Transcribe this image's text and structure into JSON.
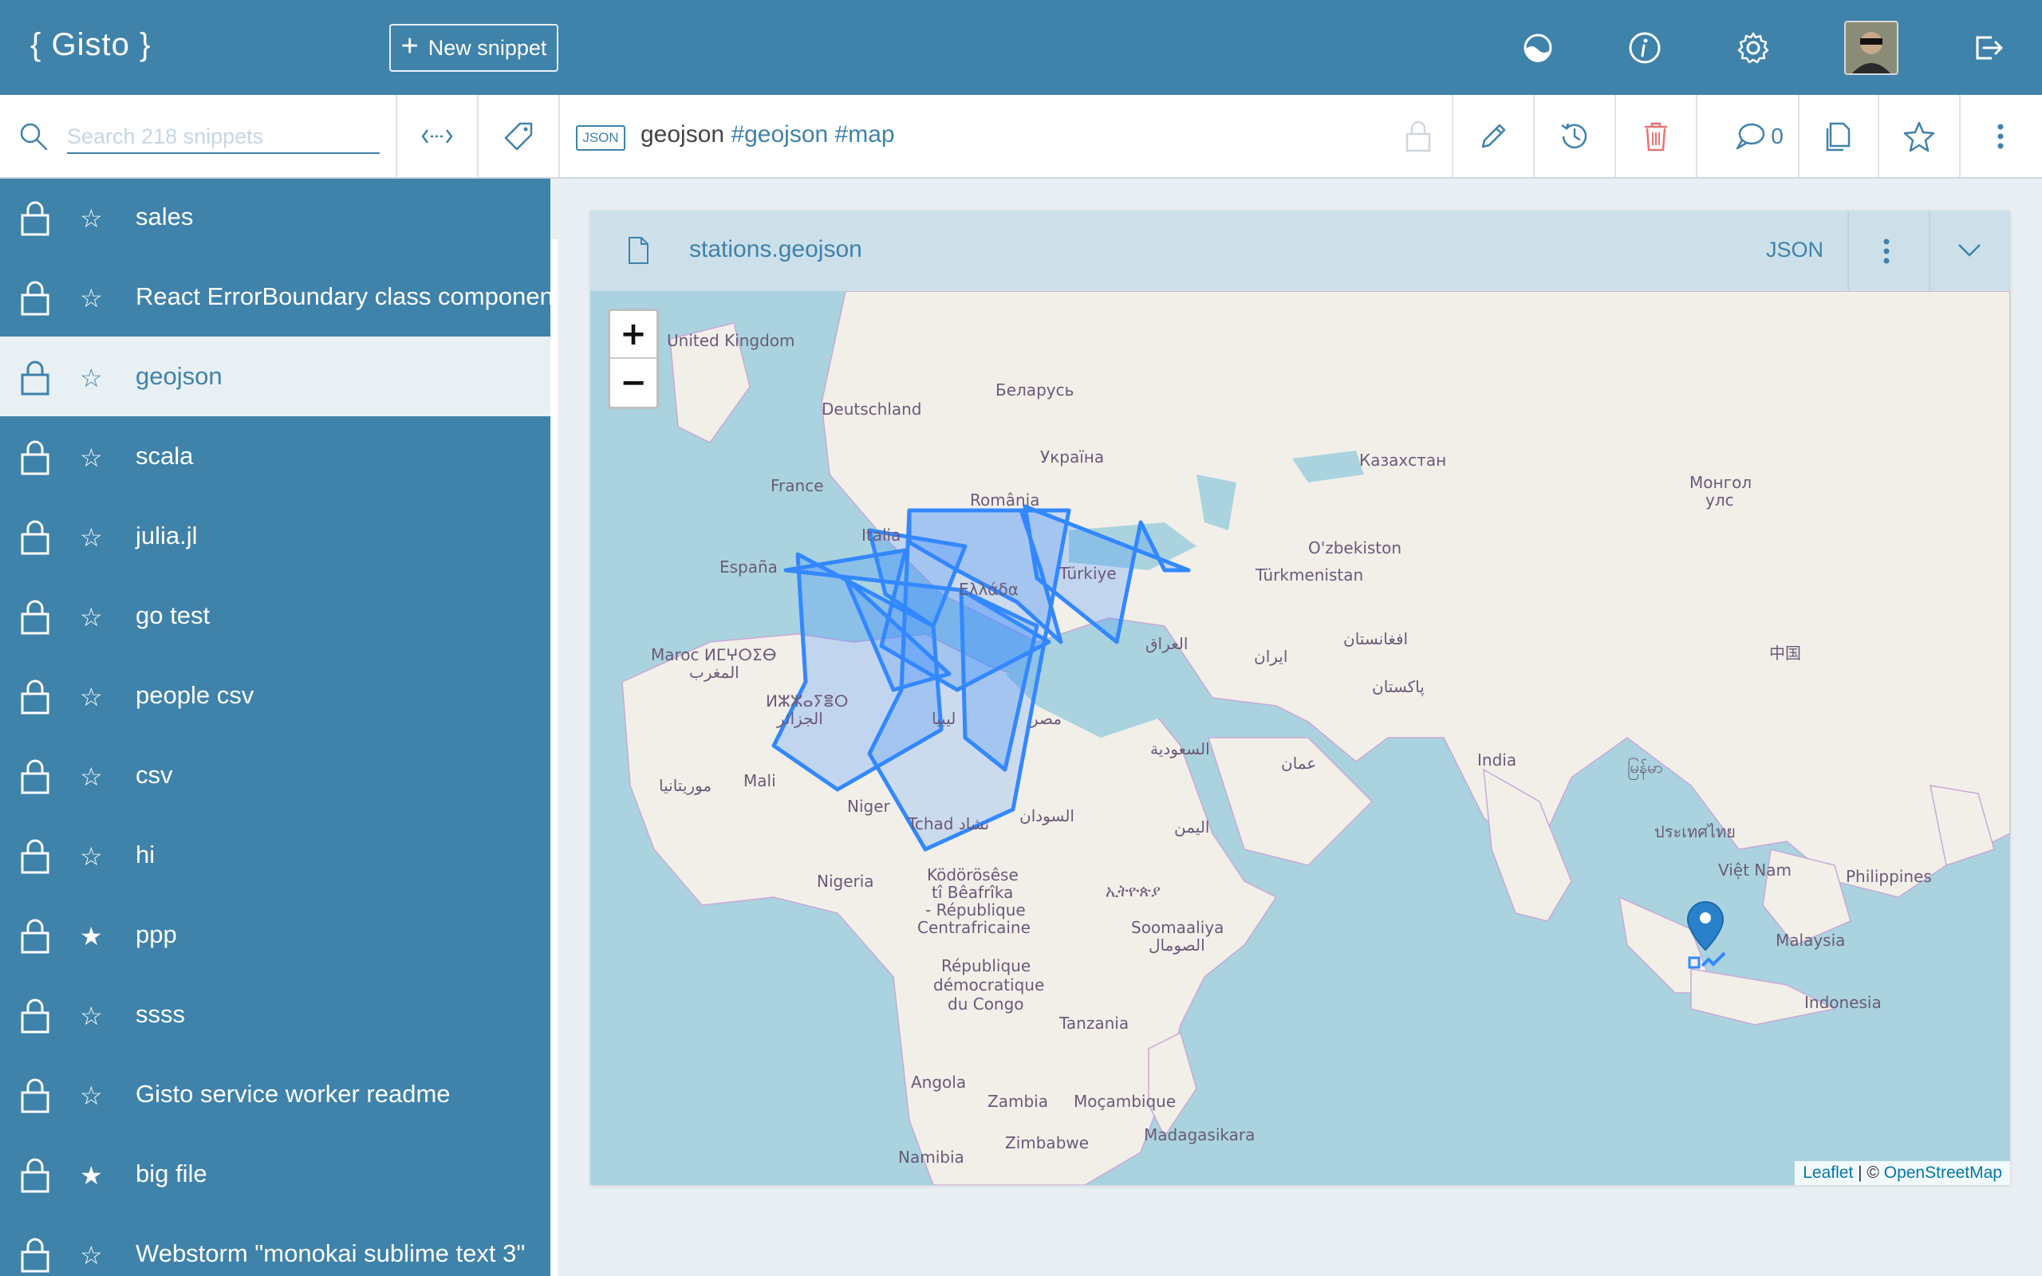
{
  "app": {
    "logo": "{ Gisto }",
    "new_snippet_label": "New snippet"
  },
  "header_icons": [
    "theme-icon",
    "info-icon",
    "settings-icon",
    "user-avatar",
    "logout-icon"
  ],
  "toolbar": {
    "search_placeholder": "Search 218 snippets",
    "snippet_lang_badge": "JSON",
    "snippet_name": "geojson",
    "snippet_tags": "#geojson #map",
    "comment_count": "0"
  },
  "sidebar": {
    "items": [
      {
        "label": "sales",
        "starred": false
      },
      {
        "label": "React ErrorBoundary class component",
        "starred": false
      },
      {
        "label": "geojson",
        "starred": false,
        "active": true
      },
      {
        "label": "scala",
        "starred": false
      },
      {
        "label": "julia.jl",
        "starred": false
      },
      {
        "label": "go test",
        "starred": false
      },
      {
        "label": "people csv",
        "starred": false
      },
      {
        "label": "csv",
        "starred": false
      },
      {
        "label": "hi",
        "starred": false
      },
      {
        "label": "ppp",
        "starred": true
      },
      {
        "label": "ssss",
        "starred": false
      },
      {
        "label": "Gisto service worker readme",
        "starred": false
      },
      {
        "label": "big file",
        "starred": true
      },
      {
        "label": "Webstorm \"monokai sublime text 3\"",
        "starred": false
      }
    ]
  },
  "file": {
    "name": "stations.geojson",
    "language": "JSON"
  },
  "map": {
    "zoom_in": "+",
    "zoom_out": "−",
    "attribution_link1": "Leaflet",
    "attribution_sep": " | © ",
    "attribution_link2": "OpenStreetMap",
    "labels": {
      "uk": "United Kingdom",
      "belarus": "Беларусь",
      "germany": "Deutschland",
      "ukraine": "Україна",
      "kazakhstan": "Казахстан",
      "mongolia": "Монгол",
      "mongolia2": "улс",
      "france": "France",
      "romania": "România",
      "italia": "Italia",
      "uzbekistan": "O'zbekiston",
      "turkiye": "Türkiye",
      "turkmenistan": "Türkmenistan",
      "espana": "España",
      "greece": "Ελλάδα",
      "iraq": "العراق",
      "china": "中国",
      "iran": "ایران",
      "afghanistan": "افغانستان",
      "pakistan": "پاکستان",
      "morocco": "Maroc ⵍⵎⵖⵔⵉⴱ",
      "morocco2": "المغرب",
      "algeria": "ⵍⵣⵣⴰⵢⴻⵔ",
      "algeria2": "الجزائر",
      "libya": "ليبيا",
      "egypt": "مصر",
      "saudi": "السعودية",
      "oman": "عمان",
      "india": "India",
      "myanmar": "မြန်မာ",
      "mauritania": "موريتانيا",
      "mali": "Mali",
      "niger": "Niger",
      "tchad": "Tchad تشاد",
      "sudan": "السودان",
      "yemen": "اليمن",
      "thailand": "ประเทศไทย",
      "vietnam": "Việt Nam",
      "philippines": "Philippines",
      "nigeria": "Nigeria",
      "car1": "Ködörösêse",
      "car2": "tî Bêafrîka",
      "car3": "- République",
      "car4": "Centrafricaine",
      "ethiopia": "ኢትዮጵያ",
      "somalia": "Soomaaliya",
      "somalia2": "الصومال",
      "malaysia": "Malaysia",
      "drc1": "République",
      "drc2": "démocratique",
      "drc3": "du Congo",
      "indonesia": "Indonesia",
      "tanzania": "Tanzania",
      "angola": "Angola",
      "zambia": "Zambia",
      "mozambique": "Moçambique",
      "madagascar": "Madagasikara",
      "zimbabwe": "Zimbabwe",
      "namibia": "Namibia"
    }
  },
  "colors": {
    "primary": "#3f82aa",
    "geojson_stroke": "#3388ff",
    "delete": "#e57373"
  }
}
